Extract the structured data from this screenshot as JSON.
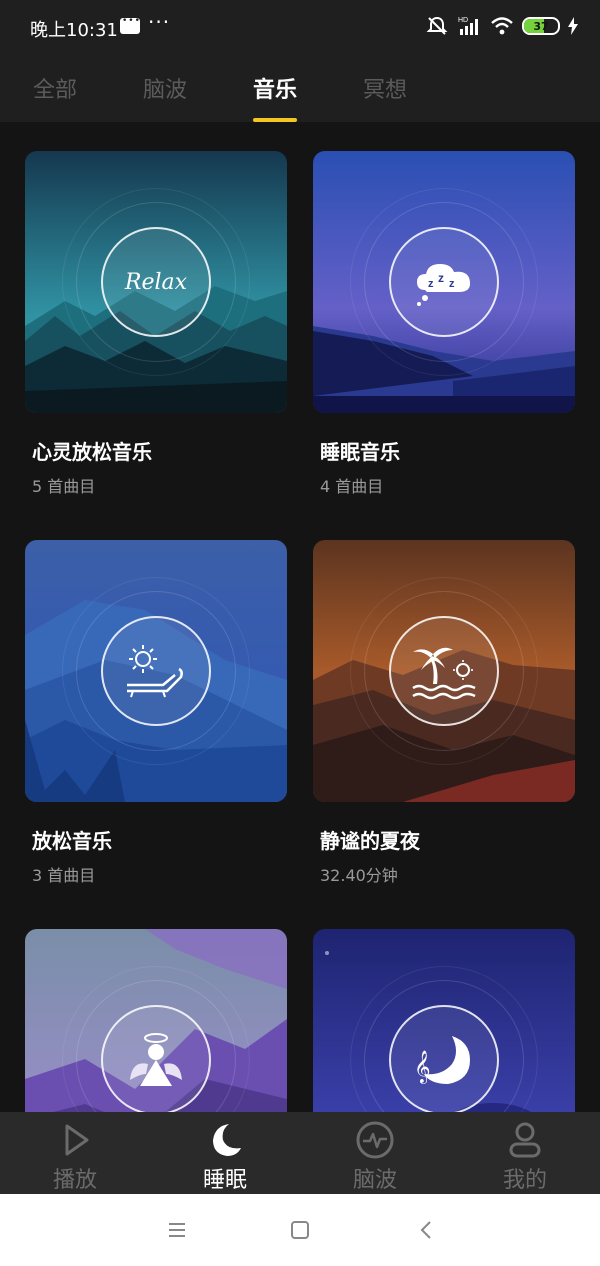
{
  "status_bar": {
    "time": "晚上10:31",
    "battery": "37"
  },
  "top_tabs": [
    {
      "label": "全部",
      "active": false
    },
    {
      "label": "脑波",
      "active": false
    },
    {
      "label": "音乐",
      "active": true
    },
    {
      "label": "冥想",
      "active": false
    }
  ],
  "cards": [
    {
      "title": "心灵放松音乐",
      "subtitle": "5 首曲目",
      "icon": "relax-text-icon"
    },
    {
      "title": "睡眠音乐",
      "subtitle": "4 首曲目",
      "icon": "zzz-cloud-icon"
    },
    {
      "title": "放松音乐",
      "subtitle": "3 首曲目",
      "icon": "sun-lounger-icon"
    },
    {
      "title": "静谧的夏夜",
      "subtitle": "32.40分钟",
      "icon": "palm-tree-icon"
    },
    {
      "title": "",
      "subtitle": "",
      "icon": "angel-icon"
    },
    {
      "title": "",
      "subtitle": "",
      "icon": "moon-music-icon"
    }
  ],
  "relax_icon_text": "Relax",
  "bottom_nav": [
    {
      "label": "播放",
      "icon": "play-icon",
      "active": false
    },
    {
      "label": "睡眠",
      "icon": "moon-icon",
      "active": true
    },
    {
      "label": "脑波",
      "icon": "pulse-icon",
      "active": false
    },
    {
      "label": "我的",
      "icon": "user-icon",
      "active": false
    }
  ],
  "colors": {
    "accent": "#f3c623",
    "background": "#141414",
    "bar": "#1f1f1f",
    "nav": "#2a2a2a"
  }
}
